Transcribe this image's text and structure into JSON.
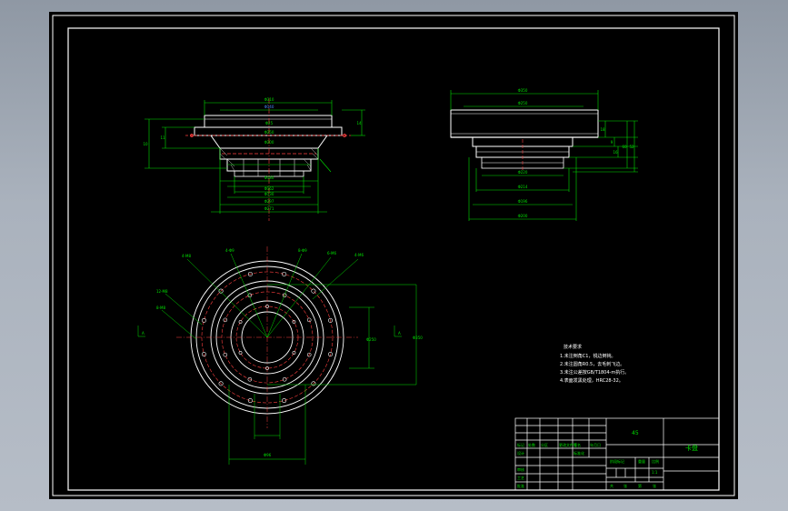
{
  "top_left_view": {
    "dimensions": [
      "Φ310",
      "Φ140",
      "Φ25",
      "Φ250",
      "Φ200",
      "Φ180",
      "Φ162",
      "Φ130",
      "Φ297",
      "Φ271"
    ],
    "side_dims": [
      "10",
      "11",
      "14"
    ]
  },
  "top_right_view": {
    "dimensions": [
      "Φ350",
      "Φ250",
      "Φ220",
      "Φ214",
      "Φ196",
      "Φ200"
    ],
    "side_dims": [
      "18",
      "9",
      "16",
      "60",
      "52"
    ]
  },
  "circle_view": {
    "callouts": [
      "4-M8",
      "4-Φ9",
      "8-Φ9",
      "6-M6",
      "4-M6",
      "12-M8",
      "8-M8"
    ],
    "dims": [
      "Φ250",
      "Φ350",
      "Φ96"
    ],
    "section_marks": [
      "A",
      "A"
    ]
  },
  "tech_requirements": {
    "title": "技术要求",
    "items": [
      "1.未注倒角C1，锐边倒钝。",
      "2.未注圆角R0.5，去毛刺飞边。",
      "3.未注公差按GB/T1804-m执行。",
      "4.表面发黑处理，HRC28-32。"
    ]
  },
  "title_block": {
    "material": "45",
    "part_name": "卡盘",
    "labels": [
      "标记",
      "处数",
      "分区",
      "更改文件号",
      "签名",
      "年月日",
      "设计",
      "标准化",
      "审核",
      "工艺",
      "批准"
    ],
    "stage_labels": [
      "阶段标记",
      "重量",
      "比例"
    ],
    "scale": "1:1",
    "sheet_labels": [
      "共",
      "张",
      "第",
      "张"
    ]
  }
}
